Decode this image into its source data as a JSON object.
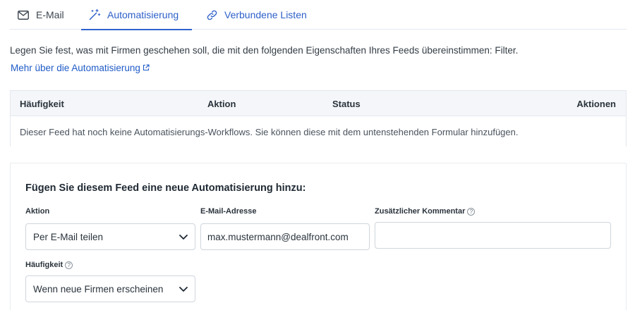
{
  "tabs": [
    {
      "label": "E-Mail",
      "icon": "mail-icon",
      "active": false
    },
    {
      "label": "Automatisierung",
      "icon": "magic-wand-icon",
      "active": true
    },
    {
      "label": "Verbundene Listen",
      "icon": "link-icon",
      "active": false
    }
  ],
  "intro": {
    "text": "Legen Sie fest, was mit Firmen geschehen soll, die mit den folgenden Eigenschaften Ihres Feeds übereinstimmen: Filter.",
    "link_label": "Mehr über die Automatisierung"
  },
  "table": {
    "columns": [
      "Häufigkeit",
      "Aktion",
      "Status",
      "Aktionen"
    ],
    "empty_text": "Dieser Feed hat noch keine Automatisierungs-Workflows. Sie können diese mit dem untenstehenden Formular hinzufügen."
  },
  "form": {
    "title": "Fügen Sie diesem Feed eine neue Automatisierung hinzu:",
    "action": {
      "label": "Aktion",
      "value": "Per E-Mail teilen"
    },
    "email": {
      "label": "E-Mail-Adresse",
      "value": "max.mustermann@dealfront.com"
    },
    "comment": {
      "label": "Zusätzlicher Kommentar",
      "value": ""
    },
    "frequency": {
      "label": "Häufigkeit",
      "value": "Wenn neue Firmen erscheinen"
    }
  },
  "colors": {
    "accent": "#2f63cc",
    "link": "#1f5bc7",
    "border": "#e3e8ee",
    "table_header_bg": "#f4f6f9"
  }
}
